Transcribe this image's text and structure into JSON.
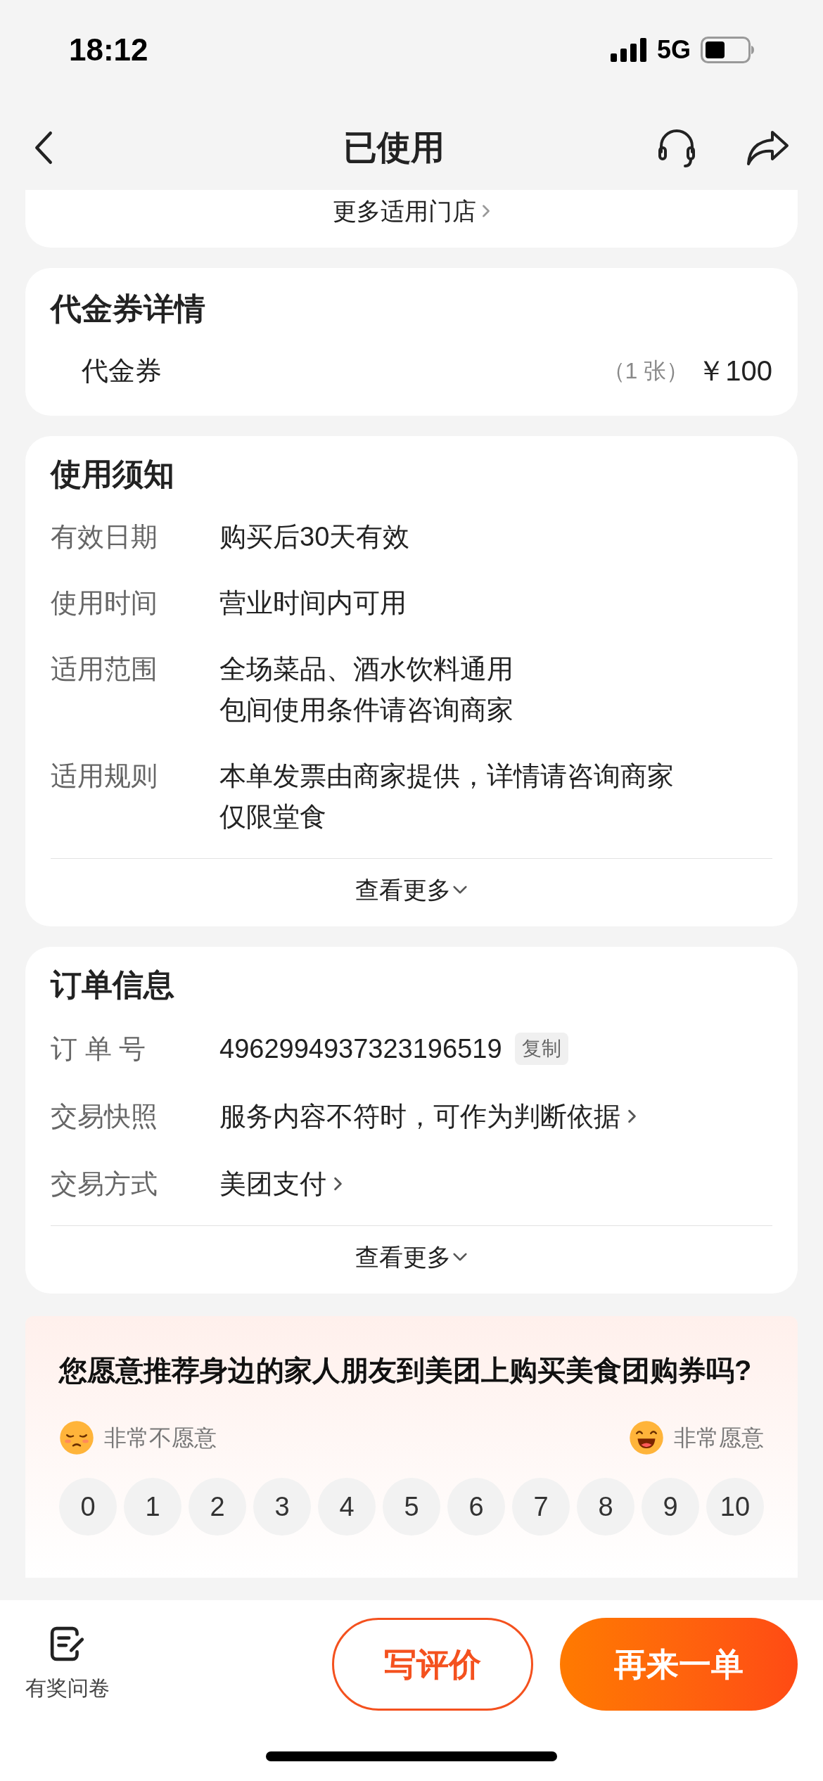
{
  "status_bar": {
    "time": "18:12",
    "network": "5G"
  },
  "nav": {
    "title": "已使用"
  },
  "stores_card": {
    "link": "更多适用门店"
  },
  "voucher": {
    "title": "代金券详情",
    "items": [
      {
        "name": "代金券",
        "quantity": "（1 张）",
        "price": "￥100"
      }
    ]
  },
  "notice": {
    "title": "使用须知",
    "rows": [
      {
        "label": "有效日期",
        "lines": [
          "购买后30天有效"
        ]
      },
      {
        "label": "使用时间",
        "lines": [
          "营业时间内可用"
        ]
      },
      {
        "label": "适用范围",
        "lines": [
          "全场菜品、酒水饮料通用",
          "包间使用条件请咨询商家"
        ]
      },
      {
        "label": "适用规则",
        "lines": [
          "本单发票由商家提供，详情请咨询商家",
          "仅限堂食"
        ]
      }
    ],
    "more": "查看更多"
  },
  "order": {
    "title": "订单信息",
    "rows": [
      {
        "kind": "copy",
        "label": "订 单 号",
        "value": "4962994937323196519",
        "action": "复制"
      },
      {
        "kind": "link",
        "label": "交易快照",
        "value": "服务内容不符时，可作为判断依据"
      },
      {
        "kind": "link",
        "label": "交易方式",
        "value": "美团支付"
      }
    ],
    "more": "查看更多"
  },
  "survey": {
    "question": "您愿意推荐身边的家人朋友到美团上购买美食团购券吗?",
    "low_label": "非常不愿意",
    "high_label": "非常愿意",
    "scores": [
      "0",
      "1",
      "2",
      "3",
      "4",
      "5",
      "6",
      "7",
      "8",
      "9",
      "10"
    ]
  },
  "bottom_bar": {
    "survey_link": "有奖问卷",
    "buttons": [
      {
        "kind": "outline",
        "label": "写评价"
      },
      {
        "kind": "filled",
        "label": "再来一单"
      }
    ]
  }
}
